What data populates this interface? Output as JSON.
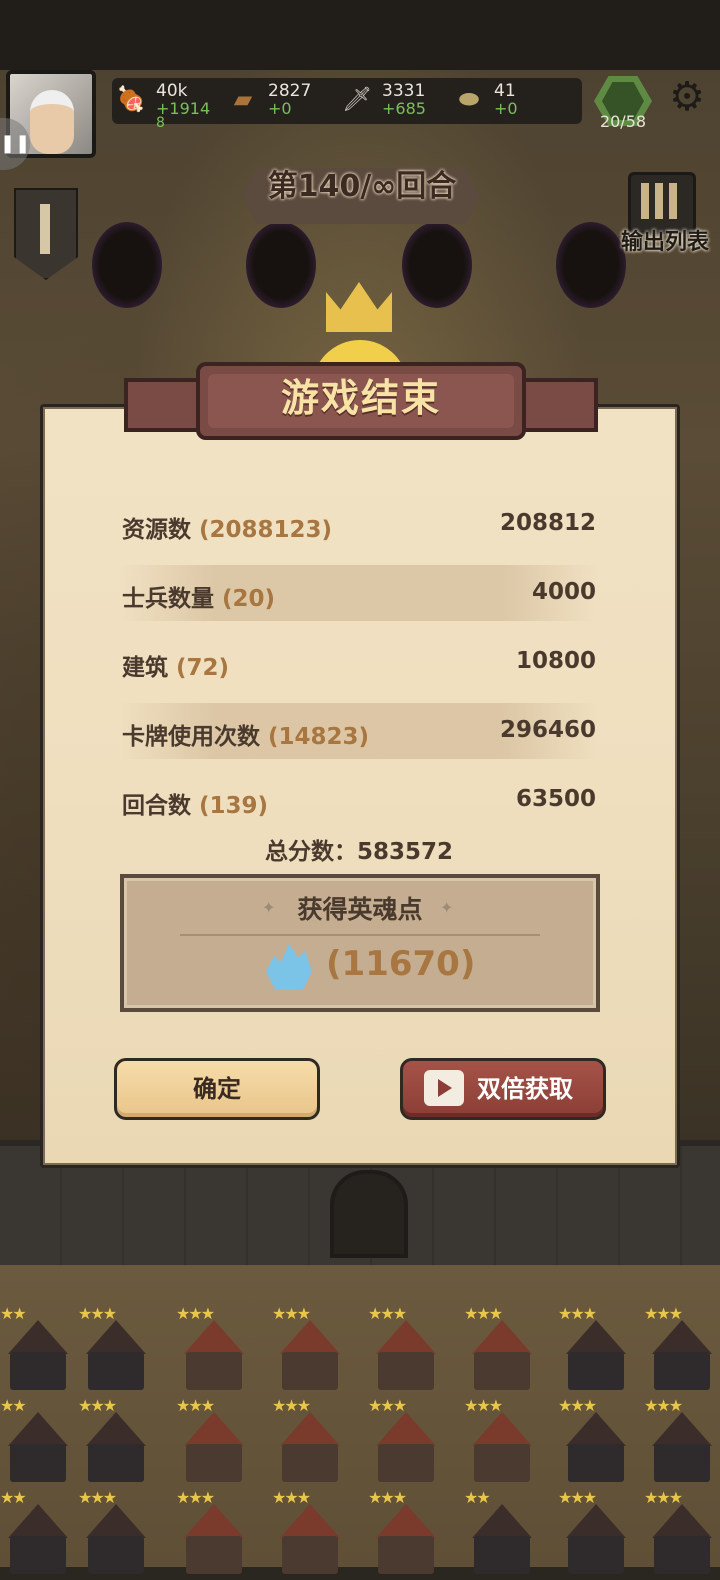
{
  "hud": {
    "resources": [
      {
        "icon": "meat-icon",
        "value": "40k",
        "increase": "+1914",
        "extra": "8"
      },
      {
        "icon": "wood-icon",
        "value": "2827",
        "increase": "+0"
      },
      {
        "icon": "sword-icon",
        "value": "3331",
        "increase": "+685"
      },
      {
        "icon": "coin-icon",
        "value": "41",
        "increase": "+0"
      }
    ],
    "heroes_count": "20/58"
  },
  "round": {
    "text": "第140/∞回合"
  },
  "side": {
    "output_list": "输出列表"
  },
  "dialog": {
    "title": "游戏结束",
    "rows": [
      {
        "label": "资源数",
        "count": "(2088123)",
        "points": "208812"
      },
      {
        "label": "士兵数量",
        "count": "(20)",
        "points": "4000"
      },
      {
        "label": "建筑",
        "count": "(72)",
        "points": "10800"
      },
      {
        "label": "卡牌使用次数",
        "count": "(14823)",
        "points": "296460"
      },
      {
        "label": "回合数",
        "count": "(139)",
        "points": "63500"
      }
    ],
    "total": "总分数：583572",
    "soul": {
      "title": "获得英魂点",
      "value": "(11670)"
    },
    "confirm": "确定",
    "double": "双倍获取"
  },
  "colors": {
    "accent": "#a87640",
    "ribbon": "#7a4a44",
    "parchment": "#efdfbf",
    "increase": "#7bbf5a"
  }
}
